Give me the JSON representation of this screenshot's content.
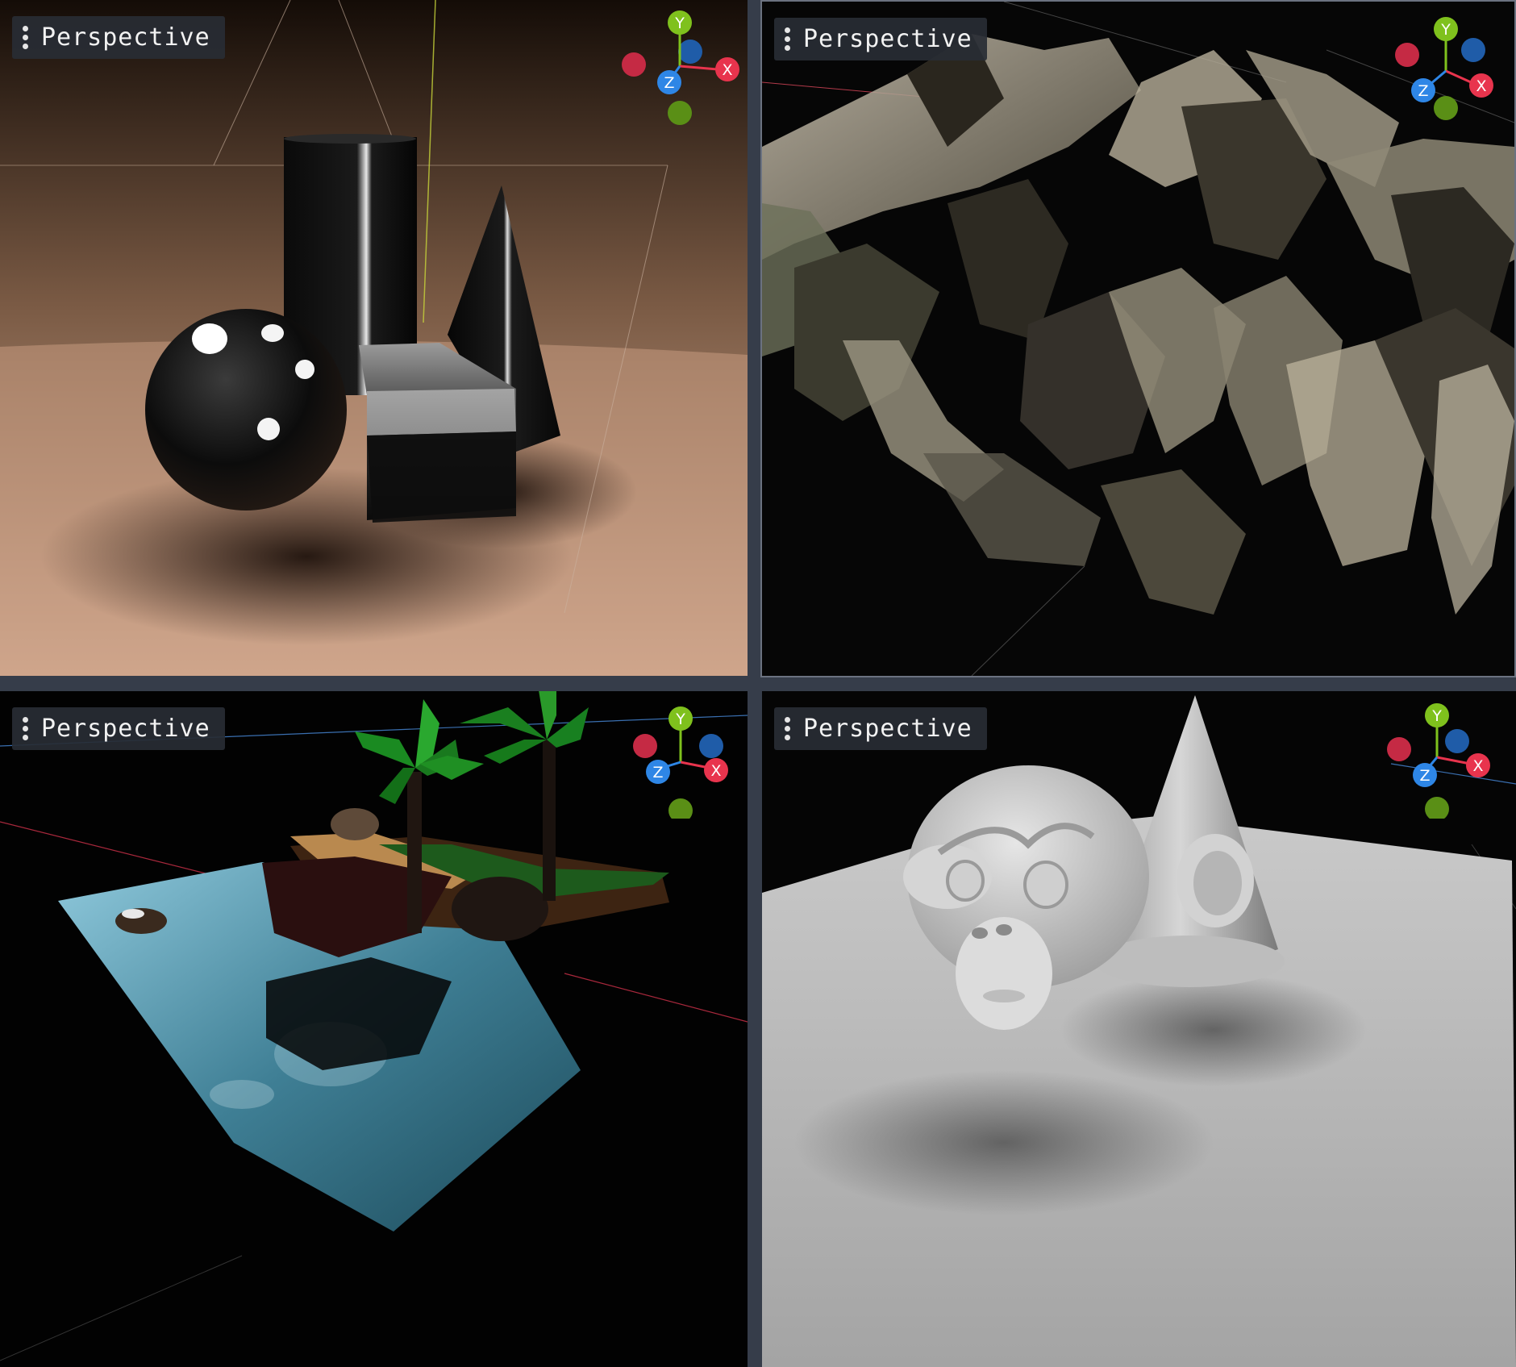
{
  "viewports": [
    {
      "id": "top-left",
      "label": "Perspective",
      "axes": {
        "x": "X",
        "y": "Y",
        "z": "Z"
      }
    },
    {
      "id": "top-right",
      "label": "Perspective",
      "axes": {
        "x": "X",
        "y": "Y",
        "z": "Z"
      }
    },
    {
      "id": "bottom-left",
      "label": "Perspective",
      "axes": {
        "x": "X",
        "y": "Y",
        "z": "Z"
      }
    },
    {
      "id": "bottom-right",
      "label": "Perspective",
      "axes": {
        "x": "X",
        "y": "Y",
        "z": "Z"
      }
    }
  ],
  "colors": {
    "x_axis": "#e8344d",
    "y_axis": "#7fc11d",
    "z_axis": "#2e86e6",
    "panel_bg": "#363d4a",
    "menu_bg": "#282c34"
  },
  "icons": {
    "menu": "kebab-menu-icon",
    "gizmo": "axis-gizmo-icon"
  }
}
